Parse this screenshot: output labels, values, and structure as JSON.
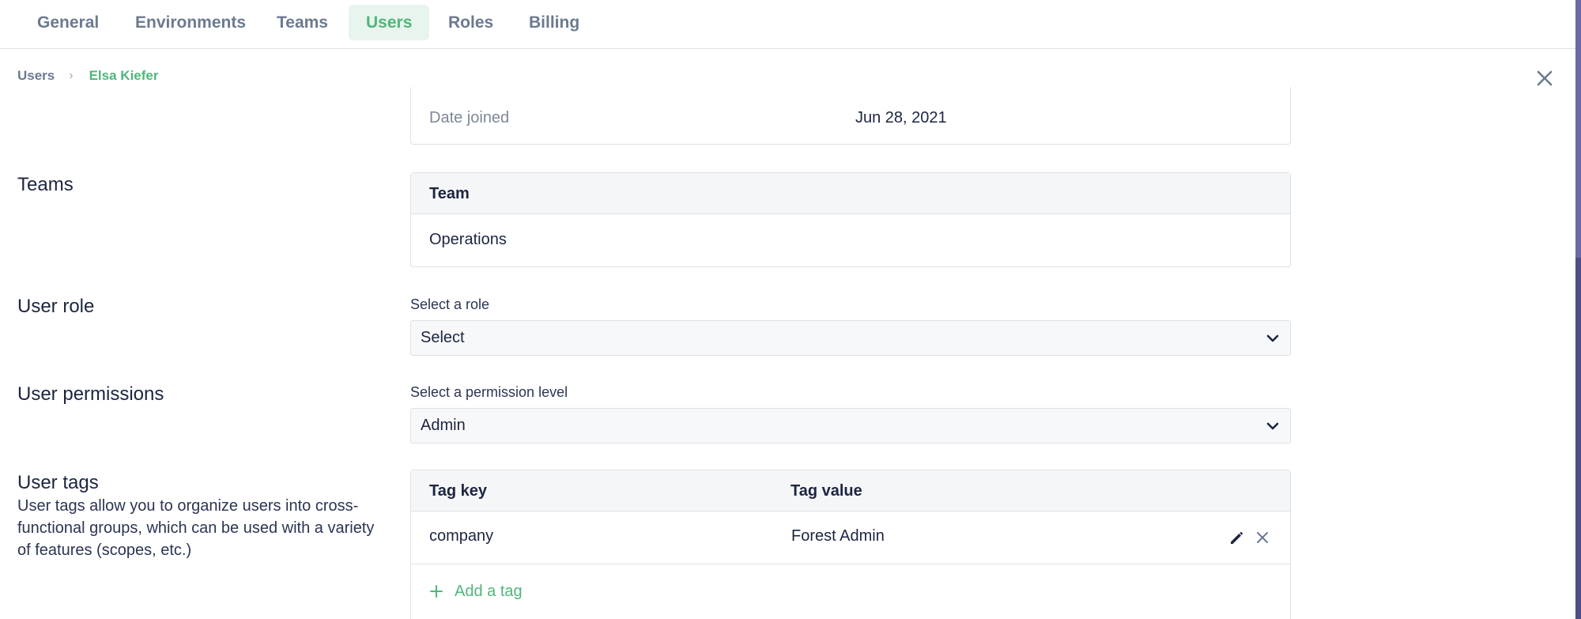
{
  "tabs": [
    {
      "label": "General",
      "active": false
    },
    {
      "label": "Environments",
      "active": false
    },
    {
      "label": "Teams",
      "active": false
    },
    {
      "label": "Users",
      "active": true
    },
    {
      "label": "Roles",
      "active": false
    },
    {
      "label": "Billing",
      "active": false
    }
  ],
  "breadcrumb": {
    "root": "Users",
    "separator": "›",
    "current": "Elsa Kiefer"
  },
  "details": {
    "date_joined_label": "Date joined",
    "date_joined_value": "Jun 28, 2021"
  },
  "teams": {
    "section_label": "Teams",
    "column": "Team",
    "rows": [
      "Operations"
    ]
  },
  "role": {
    "section_label": "User role",
    "field_label": "Select a role",
    "value": "Select"
  },
  "permissions": {
    "section_label": "User permissions",
    "field_label": "Select a permission level",
    "value": "Admin"
  },
  "tags": {
    "section_label": "User tags",
    "description": "User tags allow you to organize users into cross-functional groups, which can be used with a variety of features (scopes, etc.)",
    "columns": [
      "Tag key",
      "Tag value"
    ],
    "rows": [
      {
        "key": "company",
        "value": "Forest Admin"
      }
    ],
    "add_label": "Add a tag"
  },
  "colors": {
    "accent": "#4fb67c",
    "text": "#1c2541",
    "muted": "#6b7a8f",
    "scrollbar": "#6a6aa6"
  },
  "icons": [
    "close-icon",
    "chevron-right-icon",
    "chevron-down-icon",
    "pencil-icon",
    "x-icon",
    "plus-icon"
  ]
}
